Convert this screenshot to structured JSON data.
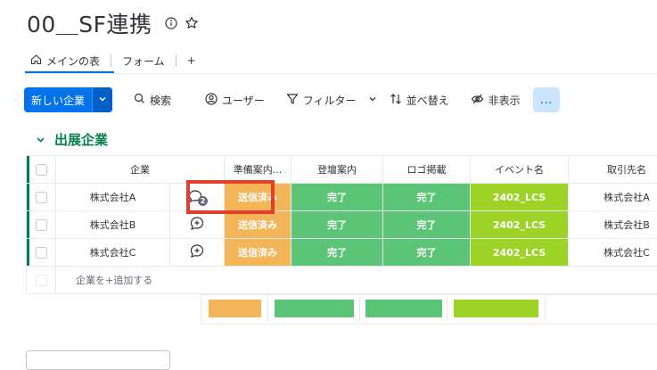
{
  "board": {
    "title": "00＿SF連携"
  },
  "tabs": [
    {
      "label": "メインの表",
      "active": true
    },
    {
      "label": "フォーム",
      "active": false
    },
    {
      "label": "+"
    }
  ],
  "toolbar": {
    "new_item": "新しい企業",
    "search": "検索",
    "person": "ユーザー",
    "filter": "フィルター",
    "sort": "並べ替え",
    "hide": "非表示",
    "more": "…"
  },
  "group": {
    "title": "出展企業",
    "color": "#037f4c"
  },
  "columns": {
    "item": "企業",
    "status1": "準備案内...",
    "status2": "登壇案内",
    "status3": "ロゴ掲載",
    "event": "イベント名",
    "partner": "取引先名"
  },
  "rows": [
    {
      "name": "株式会社A",
      "updates": "2",
      "status1": "送信済み",
      "status2": "完了",
      "status3": "完了",
      "event": "2402_LCS",
      "partner": "株式会社A"
    },
    {
      "name": "株式会社B",
      "status1": "送信済み",
      "status2": "完了",
      "status3": "完了",
      "event": "2402_LCS",
      "partner": "株式会社B"
    },
    {
      "name": "株式会社C",
      "status1": "送信済み",
      "status2": "完了",
      "status3": "完了",
      "event": "2402_LCS",
      "partner": "株式会社C"
    }
  ],
  "add_item": "企業を+追加する",
  "colors": {
    "accent": "#0073ea",
    "sent": "#fdab3d",
    "done": "#5cc476",
    "event": "#9cd326",
    "highlight": "#e2402b"
  }
}
